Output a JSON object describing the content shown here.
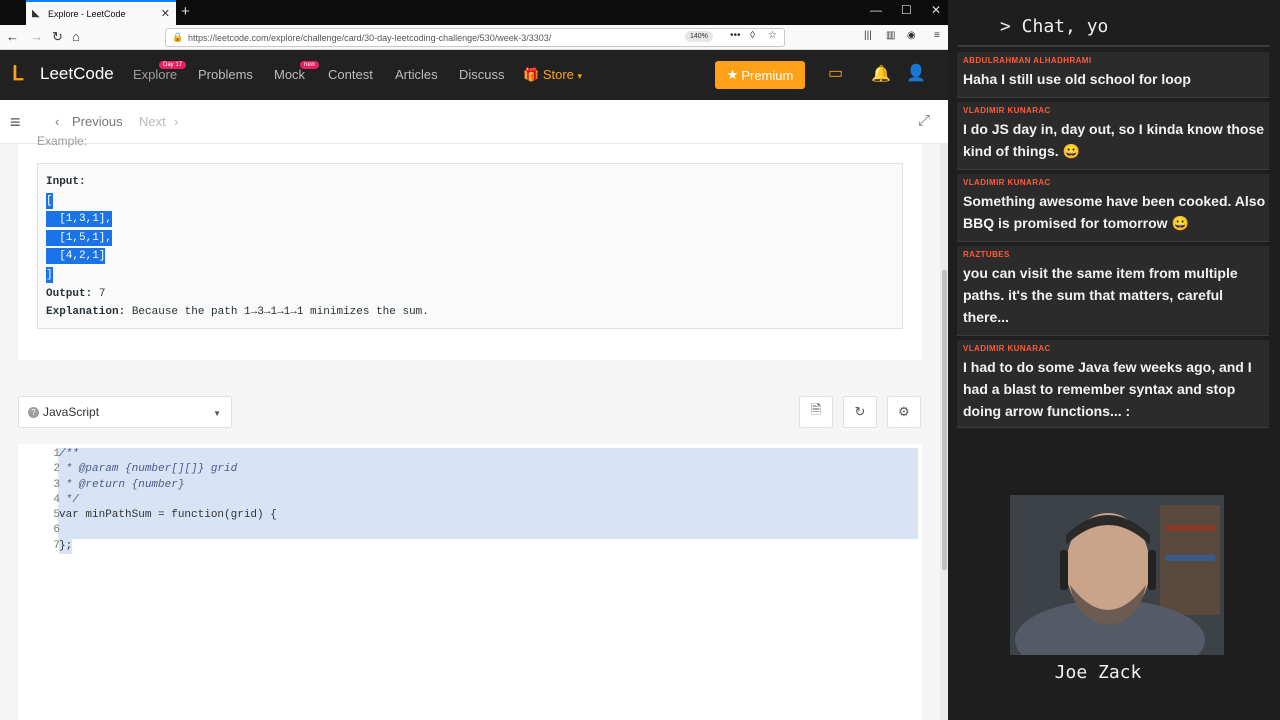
{
  "browser": {
    "tab_title": "Explore - LeetCode",
    "url": "https://leetcode.com/explore/challenge/card/30-day-leetcoding-challenge/530/week-3/3303/",
    "zoom": "140%"
  },
  "header": {
    "logo": "LeetCode",
    "nav": {
      "explore": "Explore",
      "explore_badge": "Day 17",
      "problems": "Problems",
      "mock": "Mock",
      "mock_badge": "new",
      "contest": "Contest",
      "articles": "Articles",
      "discuss": "Discuss",
      "store": "Store"
    },
    "premium": "Premium"
  },
  "toolbar": {
    "previous": "Previous",
    "next": "Next"
  },
  "example": {
    "heading": "Example:",
    "input_label": "Input:",
    "lines": [
      "[",
      "  [1,3,1],",
      "  [1,5,1],",
      "  [4,2,1]",
      "]"
    ],
    "output_label": "Output:",
    "output_value": "7",
    "explanation_label": "Explanation:",
    "explanation_text": "Because the path 1→3→1→1→1 minimizes the sum."
  },
  "editor": {
    "language": "JavaScript",
    "line_numbers": [
      "1",
      "2",
      "3",
      "4",
      "5",
      "6",
      "7"
    ],
    "lines": [
      "/**",
      " * @param {number[][]} grid",
      " * @return {number}",
      " */",
      "var minPathSum = function(grid) {",
      "",
      "};"
    ]
  },
  "chat": {
    "title": "> Chat, yo",
    "messages": [
      {
        "user": "ABDULRAHMAN ALHADHRAMI",
        "text": "Haha I still use old school for loop"
      },
      {
        "user": "VLADIMIR KUNARAC",
        "text": "I do JS day in, day out, so I kinda know those kind of things. 😀"
      },
      {
        "user": "VLADIMIR KUNARAC",
        "text": "Something awesome have been cooked. Also BBQ is promised for tomorrow 😀"
      },
      {
        "user": "RAZTUBES",
        "text": "you can visit the same item from multiple paths. it's the sum that matters, careful there..."
      },
      {
        "user": "VLADIMIR KUNARAC",
        "text": "I had to do some Java few weeks ago, and I had a blast to remember syntax and stop doing arrow functions... :"
      }
    ]
  },
  "webcam": {
    "name": "Joe Zack"
  },
  "colors": {
    "accent": "#ffa116",
    "chat_user": "#ff5a36",
    "selection": "#1a73e8"
  }
}
